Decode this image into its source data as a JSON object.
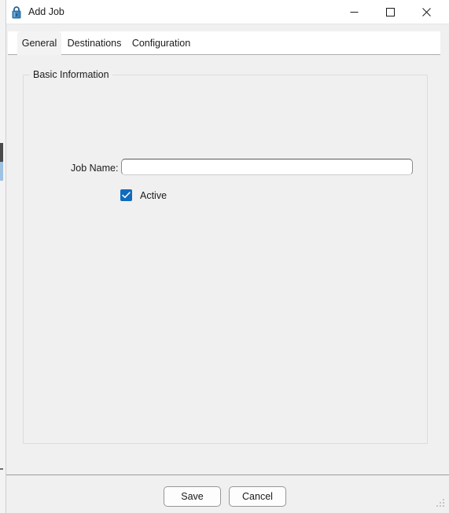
{
  "window": {
    "title": "Add Job",
    "icon": "lock-icon",
    "controls": {
      "minimize": "minimize-icon",
      "maximize": "maximize-icon",
      "close": "close-icon"
    }
  },
  "tabs": [
    {
      "id": "general",
      "label": "General",
      "selected": true
    },
    {
      "id": "destinations",
      "label": "Destinations",
      "selected": false
    },
    {
      "id": "configuration",
      "label": "Configuration",
      "selected": false
    }
  ],
  "general_tab": {
    "group": {
      "legend": "Basic Information",
      "fields": {
        "job_name": {
          "label": "Job Name:",
          "value": "",
          "placeholder": ""
        },
        "active": {
          "label": "Active",
          "checked": true
        }
      }
    }
  },
  "footer": {
    "save_label": "Save",
    "cancel_label": "Cancel"
  },
  "colors": {
    "accent": "#0f6cbd",
    "window_background": "#f0f0f0",
    "titlebar_background": "#ffffff",
    "tabstrip_background": "#ffffff",
    "selected_tab_background": "#f3f3f3",
    "text": "#1b1b1b",
    "border": "#dcdcdc",
    "divider": "#9b9b9b",
    "button_background": "#fdfdfd",
    "button_border": "#969696"
  }
}
